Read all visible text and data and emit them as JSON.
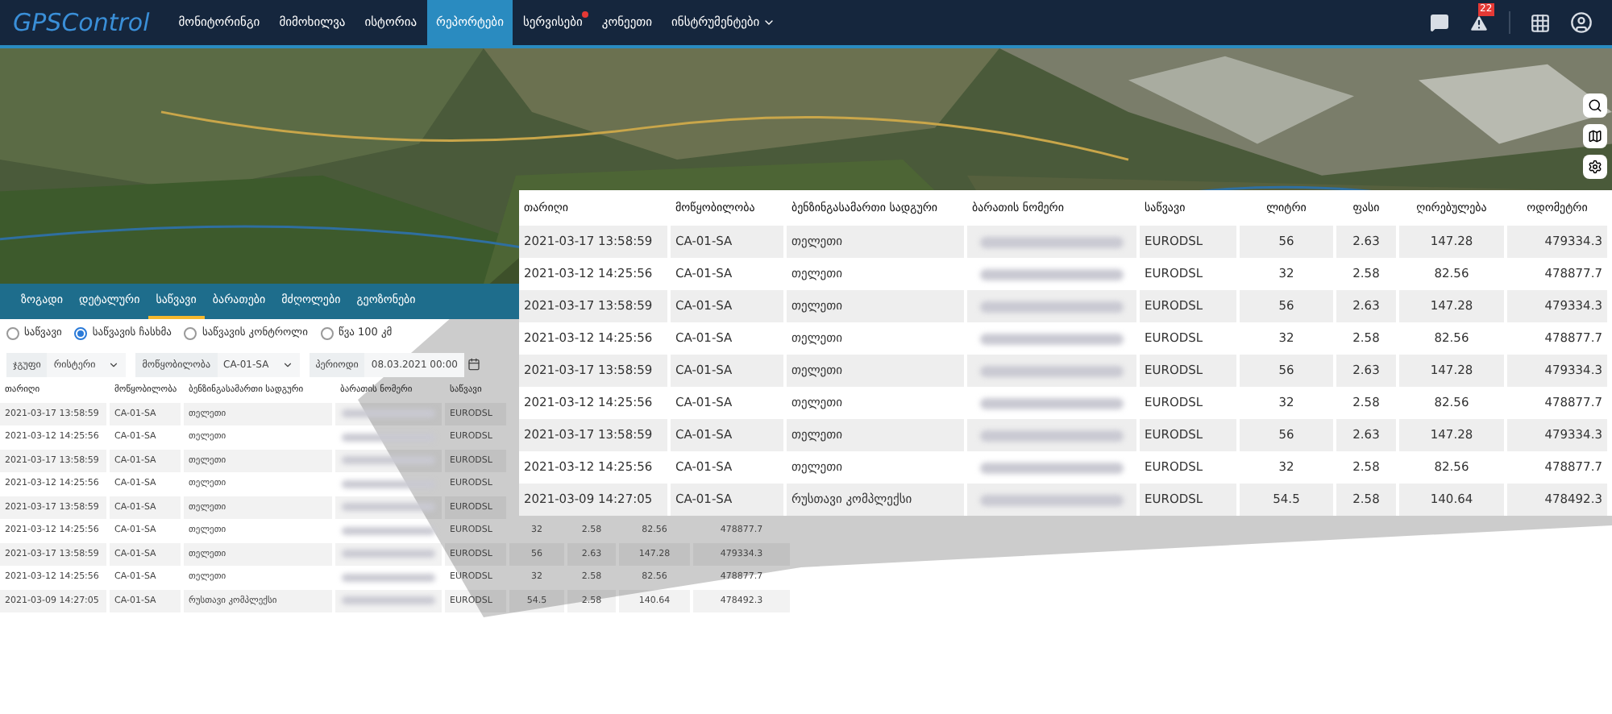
{
  "nav": {
    "logo": "GPSControl",
    "items": [
      {
        "label": "მონიტორინგი",
        "selected": false,
        "alert": false
      },
      {
        "label": "მიმოხილვა",
        "selected": false,
        "alert": false
      },
      {
        "label": "ისტორია",
        "selected": false,
        "alert": false
      },
      {
        "label": "რეპორტები",
        "selected": true,
        "alert": false
      },
      {
        "label": "სერვისები",
        "selected": false,
        "alert": true
      },
      {
        "label": "კონეეთი",
        "selected": false,
        "alert": false
      },
      {
        "label": "ინსტრუმენტები",
        "selected": false,
        "alert": false,
        "menu": true
      }
    ],
    "notifications": "22"
  },
  "report_tabs": [
    {
      "label": "ზოგადი",
      "selected": false
    },
    {
      "label": "დეტალური",
      "selected": false
    },
    {
      "label": "საწვავი",
      "selected": true
    },
    {
      "label": "ბარათები",
      "selected": false
    },
    {
      "label": "მძღოლები",
      "selected": false
    },
    {
      "label": "გეოზონები",
      "selected": false
    }
  ],
  "modes": [
    {
      "label": "საწვავი",
      "selected": false
    },
    {
      "label": "საწვავის ჩასხმა",
      "selected": true
    },
    {
      "label": "საწვავის კონტროლი",
      "selected": false
    },
    {
      "label": "წვა 100 კმ",
      "selected": false
    }
  ],
  "filters": [
    {
      "label": "ჯგუფი",
      "value": "რისტერი",
      "kind": "select"
    },
    {
      "label": "მოწყობილობა",
      "value": "CA-01-SA",
      "kind": "select"
    },
    {
      "label": "პერიოდი",
      "value": "08.03.2021 00:00",
      "kind": "date"
    }
  ],
  "table": {
    "columns": [
      "თარიღი",
      "მოწყობილობა",
      "ბენზინგასამართი სადგური",
      "ბარათის ნომერი",
      "საწვავი"
    ],
    "rows": [
      {
        "date": "2021-03-17 13:58:59",
        "device": "CA-01-SA",
        "station": "თელეთი",
        "fuel": "EURODSL"
      },
      {
        "date": "2021-03-12 14:25:56",
        "device": "CA-01-SA",
        "station": "თელეთი",
        "fuel": "EURODSL"
      },
      {
        "date": "2021-03-17 13:58:59",
        "device": "CA-01-SA",
        "station": "თელეთი",
        "fuel": "EURODSL"
      },
      {
        "date": "2021-03-12 14:25:56",
        "device": "CA-01-SA",
        "station": "თელეთი",
        "fuel": "EURODSL"
      },
      {
        "date": "2021-03-17 13:58:59",
        "device": "CA-01-SA",
        "station": "თელეთი",
        "fuel": "EURODSL"
      },
      {
        "date": "2021-03-12 14:25:56",
        "device": "CA-01-SA",
        "station": "თელეთი",
        "fuel": "EURODSL",
        "liters": "32",
        "price": "2.58",
        "value": "82.56",
        "odometer": "478877.7"
      },
      {
        "date": "2021-03-17 13:58:59",
        "device": "CA-01-SA",
        "station": "თელეთი",
        "fuel": "EURODSL",
        "liters": "56",
        "price": "2.63",
        "value": "147.28",
        "odometer": "479334.3"
      },
      {
        "date": "2021-03-12 14:25:56",
        "device": "CA-01-SA",
        "station": "თელეთი",
        "fuel": "EURODSL",
        "liters": "32",
        "price": "2.58",
        "value": "82.56",
        "odometer": "478877.7"
      },
      {
        "date": "2021-03-09 14:27:05",
        "device": "CA-01-SA",
        "station": "რუსთავი კომპლექსი",
        "fuel": "EURODSL",
        "liters": "54.5",
        "price": "2.58",
        "value": "140.64",
        "odometer": "478492.3"
      }
    ]
  },
  "magnified": {
    "columns": [
      "თარიღი",
      "მოწყობილობა",
      "ბენზინგასამართი სადგური",
      "ბარათის ნომერი",
      "საწვავი",
      "ლიტრი",
      "ფასი",
      "ღირებულება",
      "ოდომეტრი"
    ],
    "rows": [
      {
        "date": "2021-03-17 13:58:59",
        "device": "CA-01-SA",
        "station": "თელეთი",
        "fuel": "EURODSL",
        "liters": "56",
        "price": "2.63",
        "value": "147.28",
        "odometer": "479334.3"
      },
      {
        "date": "2021-03-12 14:25:56",
        "device": "CA-01-SA",
        "station": "თელეთი",
        "fuel": "EURODSL",
        "liters": "32",
        "price": "2.58",
        "value": "82.56",
        "odometer": "478877.7"
      },
      {
        "date": "2021-03-17 13:58:59",
        "device": "CA-01-SA",
        "station": "თელეთი",
        "fuel": "EURODSL",
        "liters": "56",
        "price": "2.63",
        "value": "147.28",
        "odometer": "479334.3"
      },
      {
        "date": "2021-03-12 14:25:56",
        "device": "CA-01-SA",
        "station": "თელეთი",
        "fuel": "EURODSL",
        "liters": "32",
        "price": "2.58",
        "value": "82.56",
        "odometer": "478877.7"
      },
      {
        "date": "2021-03-17 13:58:59",
        "device": "CA-01-SA",
        "station": "თელეთი",
        "fuel": "EURODSL",
        "liters": "56",
        "price": "2.63",
        "value": "147.28",
        "odometer": "479334.3"
      },
      {
        "date": "2021-03-12 14:25:56",
        "device": "CA-01-SA",
        "station": "თელეთი",
        "fuel": "EURODSL",
        "liters": "32",
        "price": "2.58",
        "value": "82.56",
        "odometer": "478877.7"
      },
      {
        "date": "2021-03-17 13:58:59",
        "device": "CA-01-SA",
        "station": "თელეთი",
        "fuel": "EURODSL",
        "liters": "56",
        "price": "2.63",
        "value": "147.28",
        "odometer": "479334.3"
      },
      {
        "date": "2021-03-12 14:25:56",
        "device": "CA-01-SA",
        "station": "თელეთი",
        "fuel": "EURODSL",
        "liters": "32",
        "price": "2.58",
        "value": "82.56",
        "odometer": "478877.7"
      },
      {
        "date": "2021-03-09 14:27:05",
        "device": "CA-01-SA",
        "station": "რუსთავი კომპლექსი",
        "fuel": "EURODSL",
        "liters": "54.5",
        "price": "2.58",
        "value": "140.64",
        "odometer": "478492.3"
      }
    ]
  }
}
